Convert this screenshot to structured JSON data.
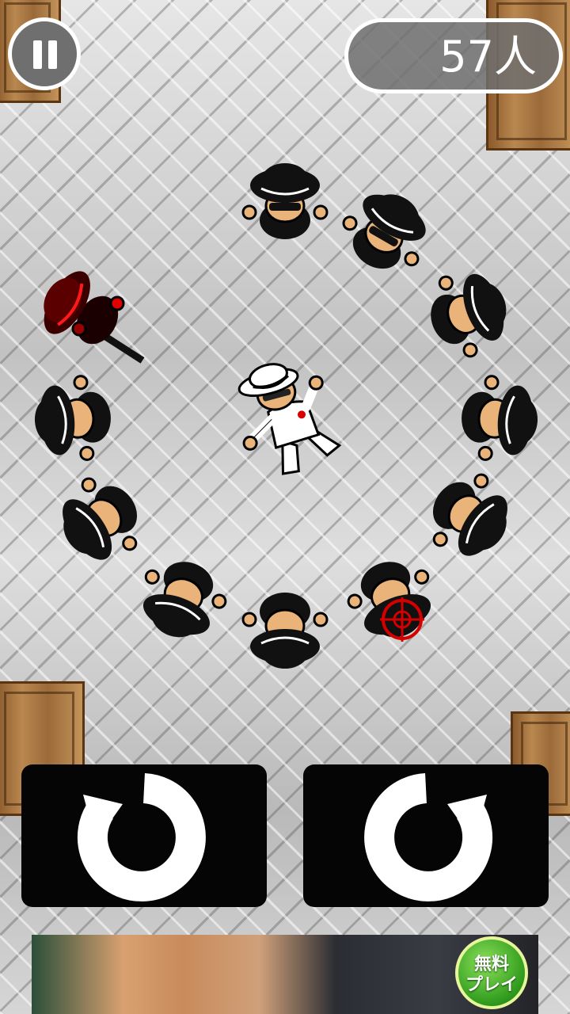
{
  "hud": {
    "pause_button": {
      "icon": "pause-icon"
    },
    "survivor_count": "57人"
  },
  "controls": {
    "rotate_left": {
      "icon": "rotate-counterclockwise-icon"
    },
    "rotate_right": {
      "icon": "rotate-clockwise-icon"
    }
  },
  "ad_banner": {
    "badge_line1": "無料",
    "badge_line2": "プレイ"
  },
  "colors": {
    "player_suit": "#ffffff",
    "enemy_suit": "#111111",
    "targeted_enemy": "#c40000",
    "hud_bg": "#6f6f6f",
    "control_bg": "#050505",
    "crosshair": "#d40000"
  }
}
